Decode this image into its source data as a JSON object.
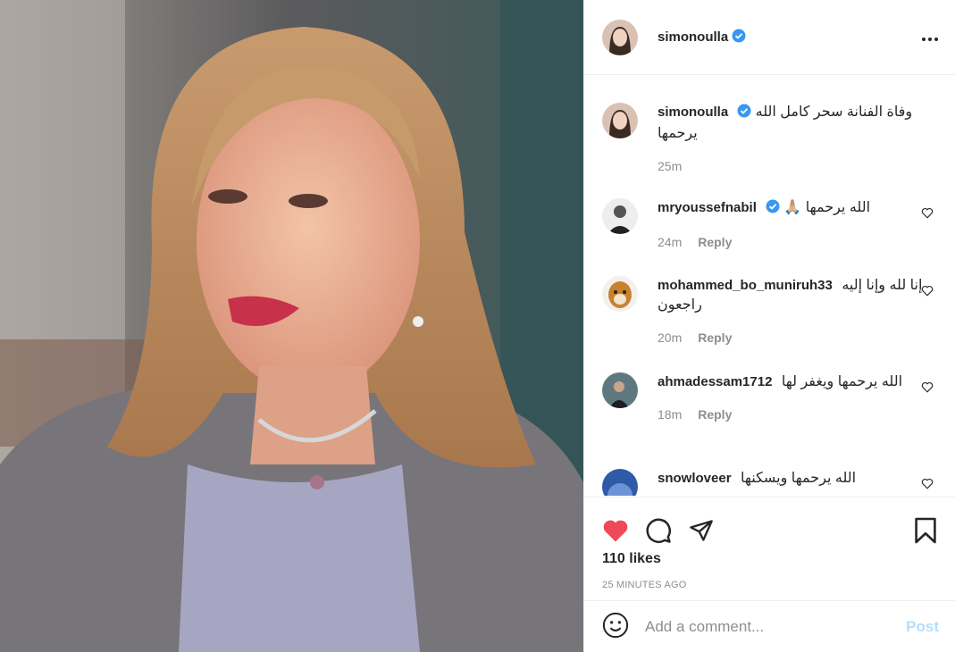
{
  "post": {
    "photo_alt": "Post photo",
    "author": "simonoulla",
    "caption": "وفاة الفنانة سحر كامل الله يرحمها",
    "caption_time": "25m"
  },
  "comments": [
    {
      "user": "mryoussefnabil",
      "verified": true,
      "text": "الله يرحمها 🙏🏼",
      "time": "24m",
      "reply": "Reply"
    },
    {
      "user": "mohammed_bo_muniruh33",
      "verified": false,
      "text": "إنا لله وإنا إليه راجعون",
      "time": "20m",
      "reply": "Reply"
    },
    {
      "user": "ahmadessam1712",
      "verified": false,
      "text": "الله يرحمها ويغفر لها",
      "time": "18m",
      "reply": "Reply"
    },
    {
      "user": "snowloveer",
      "verified": false,
      "text": "الله يرحمها ويسكنها",
      "time": "",
      "reply": ""
    }
  ],
  "stats": {
    "likes": "110 likes",
    "time_ago": "25 MINUTES AGO"
  },
  "composer": {
    "placeholder": "Add a comment...",
    "post_label": "Post"
  },
  "icons": {
    "like": "heart-filled-icon",
    "comment": "comment-bubble-icon",
    "share": "paper-plane-icon",
    "save": "bookmark-icon",
    "more": "more-horizontal-icon",
    "emoji": "emoji-smile-icon",
    "verified": "verified-badge-icon"
  },
  "colors": {
    "like_red": "#ed4956",
    "verified_blue": "#3897f0",
    "post_disabled": "#b2dffc",
    "muted": "#8e8e8e"
  }
}
